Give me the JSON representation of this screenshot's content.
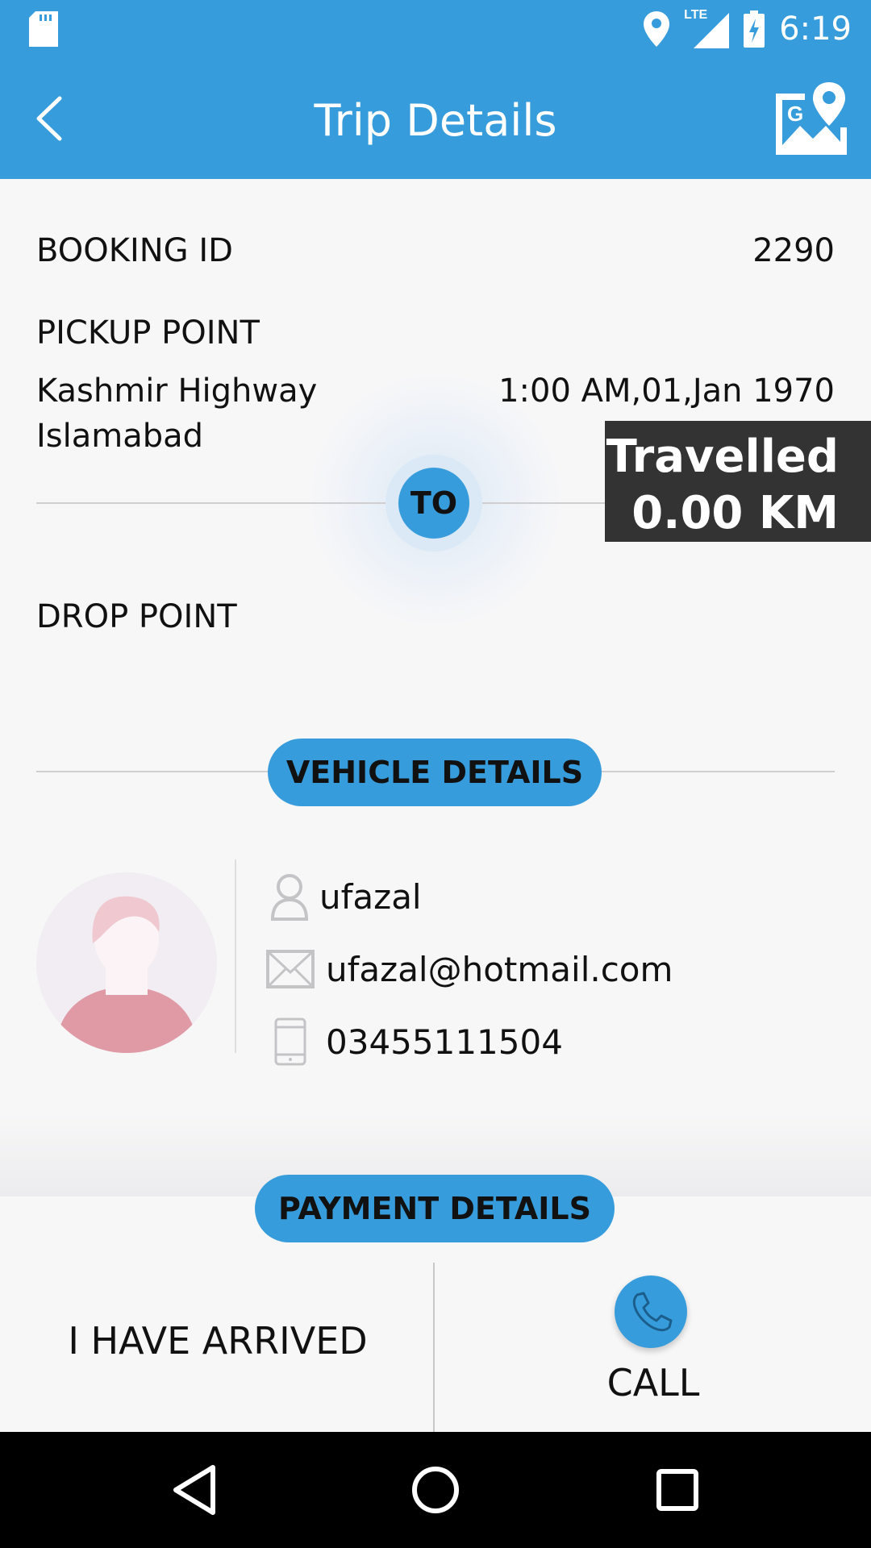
{
  "status_bar": {
    "time": "6:19",
    "network": "LTE"
  },
  "header": {
    "title": "Trip Details",
    "map_button_label": "G"
  },
  "booking": {
    "label": "BOOKING ID",
    "value": "2290"
  },
  "pickup": {
    "label": "PICKUP POINT",
    "address_line1": "Kashmir Highway",
    "address_line2": "Islamabad",
    "datetime": "1:00 AM,01,Jan 1970"
  },
  "to_badge": "TO",
  "travelled": {
    "line1": "Travelled",
    "line2": "0.00 KM"
  },
  "drop": {
    "label": "DROP POINT"
  },
  "vehicle_section": {
    "label": "VEHICLE DETAILS"
  },
  "driver": {
    "name": "ufazal",
    "email": "ufazal@hotmail.com",
    "phone": "03455111504"
  },
  "payment_section": {
    "label": "PAYMENT DETAILS"
  },
  "actions": {
    "arrived_label": "I HAVE ARRIVED",
    "call_label": "CALL"
  },
  "colors": {
    "primary": "#379cdb",
    "overlay_dark": "#333333",
    "background": "#f7f7f8"
  }
}
